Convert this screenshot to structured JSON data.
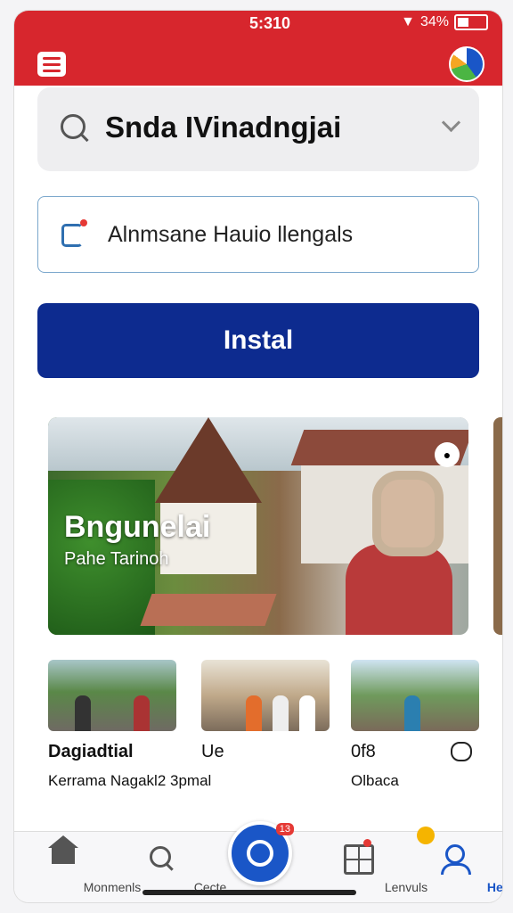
{
  "status_bar": {
    "time": "5:310",
    "battery": "34%"
  },
  "search": {
    "value": "Snda IVinadngjai"
  },
  "field": {
    "value": "Alnmsane Hauio llengals"
  },
  "install_button": {
    "label": "Instal"
  },
  "hero": {
    "title": "Bngunelai",
    "subtitle": "Pahe Tarinoh"
  },
  "cards": [
    {
      "title": "Dagiadtial",
      "subtitle": "Kerrama Nagakl2 3pmal"
    },
    {
      "title": "Ue",
      "subtitle": ""
    },
    {
      "title": "0f8",
      "subtitle": "Olbaca"
    }
  ],
  "nav": {
    "items": [
      {
        "label": "Monmenls"
      },
      {
        "label": "Cecte"
      },
      {
        "label": ""
      },
      {
        "label": "Lenvuls"
      },
      {
        "label": "Heeat"
      }
    ],
    "fab_badge": "13"
  },
  "colors": {
    "header": "#d7262d",
    "primary": "#0d2b8f",
    "accent": "#1a56c7"
  }
}
